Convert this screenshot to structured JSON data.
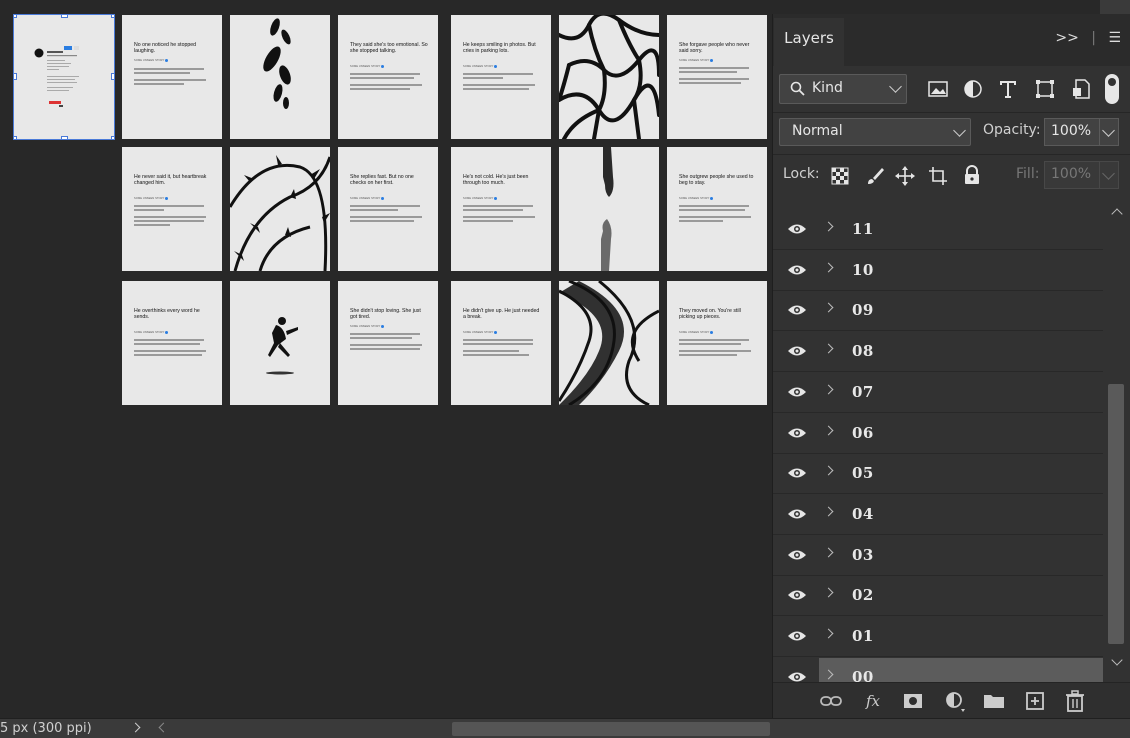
{
  "panel": {
    "tab_label": "Layers",
    "filter_kind": "Kind",
    "blend_mode": "Normal",
    "opacity_label": "Opacity:",
    "opacity_value": "100%",
    "lock_label": "Lock:",
    "fill_label": "Fill:",
    "fill_value": "100%"
  },
  "layers": [
    {
      "name": "11"
    },
    {
      "name": "10"
    },
    {
      "name": "09"
    },
    {
      "name": "08"
    },
    {
      "name": "07"
    },
    {
      "name": "06"
    },
    {
      "name": "05"
    },
    {
      "name": "04"
    },
    {
      "name": "03"
    },
    {
      "name": "02"
    },
    {
      "name": "01"
    },
    {
      "name": "00",
      "selected": true
    }
  ],
  "artboards": {
    "r0c1": {
      "title": "No one noticed he stopped laughing."
    },
    "r0c3": {
      "title": "They said she's too emotional. So she stopped talking."
    },
    "r0c4": {
      "title": "He keeps smiling in photos. But cries in parking lots."
    },
    "r0c6": {
      "title": "She forgave people who never said sorry."
    },
    "r1c0": {
      "title": "He never said it, but heartbreak changed him."
    },
    "r1c2": {
      "title": "She replies fast. But no one checks on her first."
    },
    "r1c3": {
      "title": "He's not cold. He's just been through too much."
    },
    "r1c5": {
      "title": "She outgrew people she used to beg to stay."
    },
    "r2c0": {
      "title": "He overthinks every word he sends."
    },
    "r2c2": {
      "title": "She didn't stop loving. She just got tired."
    },
    "r2c3": {
      "title": "He didn't give up. He just needed a break."
    },
    "r2c5": {
      "title": "They moved on. You're still picking up pieces."
    },
    "meta": "SOME UNSEEN STORY"
  },
  "status": {
    "doc_info": "5 px (300 ppi)"
  },
  "colors": {
    "accent": "#4a7ad8",
    "panel_bg": "#323232",
    "canvas_bg": "#282828",
    "selected_row": "#5c5c5c"
  }
}
